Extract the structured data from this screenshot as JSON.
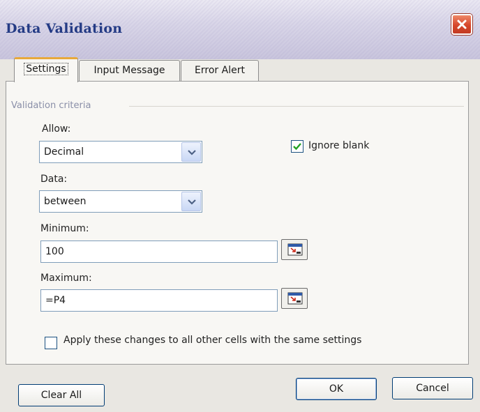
{
  "window": {
    "title": "Data Validation"
  },
  "tabs": [
    {
      "label": "Settings",
      "active": true
    },
    {
      "label": "Input Message",
      "active": false
    },
    {
      "label": "Error Alert",
      "active": false
    }
  ],
  "settings": {
    "group_title": "Validation criteria",
    "allow": {
      "label": "Allow:",
      "value": "Decimal"
    },
    "ignore_blank": {
      "label": "Ignore blank",
      "checked": true
    },
    "data": {
      "label": "Data:",
      "value": "between"
    },
    "minimum": {
      "label": "Minimum:",
      "value": "100"
    },
    "maximum": {
      "label": "Maximum:",
      "value": "=P4"
    },
    "apply_all": {
      "label": "Apply these changes to all other cells with the same settings",
      "checked": false
    }
  },
  "buttons": {
    "clear_all": "Clear All",
    "ok": "OK",
    "cancel": "Cancel"
  },
  "colors": {
    "title_text": "#243b85",
    "close_button": "#d6462b",
    "active_tab_accent": "#e8a93a",
    "check_mark": "#21a121"
  },
  "icons": {
    "close": "close-icon",
    "dropdown": "chevron-down-icon",
    "collapse_dialog": "collapse-dialog-icon",
    "check": "check-icon"
  }
}
